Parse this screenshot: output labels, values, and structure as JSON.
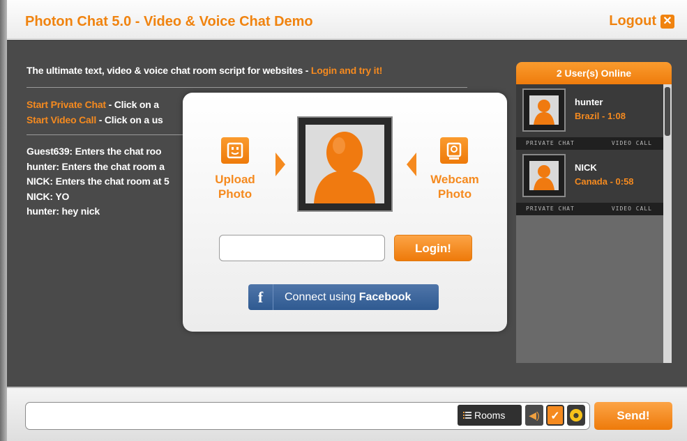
{
  "header": {
    "title": "Photon Chat 5.0 - Video & Voice Chat Demo",
    "logout_label": "Logout",
    "logout_icon": "close-icon"
  },
  "main": {
    "tagline_prefix": "The ultimate text, video & voice chat room script for websites - ",
    "tagline_link": "Login and try it!",
    "hints": [
      {
        "link": "Start Private Chat",
        "text": " - Click on a"
      },
      {
        "link": "Start Video Call",
        "text": " - Click on a us"
      }
    ],
    "messages": [
      {
        "user": "Guest639:",
        "text": " Enters the chat roo"
      },
      {
        "user": "hunter:",
        "text": " Enters the chat room a"
      },
      {
        "user": "NICK:",
        "text": " Enters the chat room at 5"
      },
      {
        "user": "NICK:",
        "text": " YO"
      },
      {
        "user": "hunter:",
        "text": " hey nick"
      }
    ]
  },
  "users_panel": {
    "header": "2 User(s) Online",
    "users": [
      {
        "name": "hunter",
        "location": "Brazil - 1:08",
        "private_chat": "PRIVATE CHAT",
        "video_call": "VIDEO CALL"
      },
      {
        "name": "NICK",
        "location": "Canada - 0:58",
        "private_chat": "PRIVATE CHAT",
        "video_call": "VIDEO CALL"
      }
    ]
  },
  "login_modal": {
    "upload_label_line1": "Upload",
    "upload_label_line2": "Photo",
    "webcam_label_line1": "Webcam",
    "webcam_label_line2": "Photo",
    "username_value": "",
    "login_button": "Login!",
    "facebook_prefix": "Connect using ",
    "facebook_brand": "Facebook",
    "facebook_icon_letter": "f"
  },
  "footer": {
    "message_value": "",
    "rooms_label": "Rooms",
    "send_label": "Send!"
  },
  "colors": {
    "accent": "#f58a1f",
    "background": "#4a4a4a",
    "facebook": "#3b5998"
  }
}
